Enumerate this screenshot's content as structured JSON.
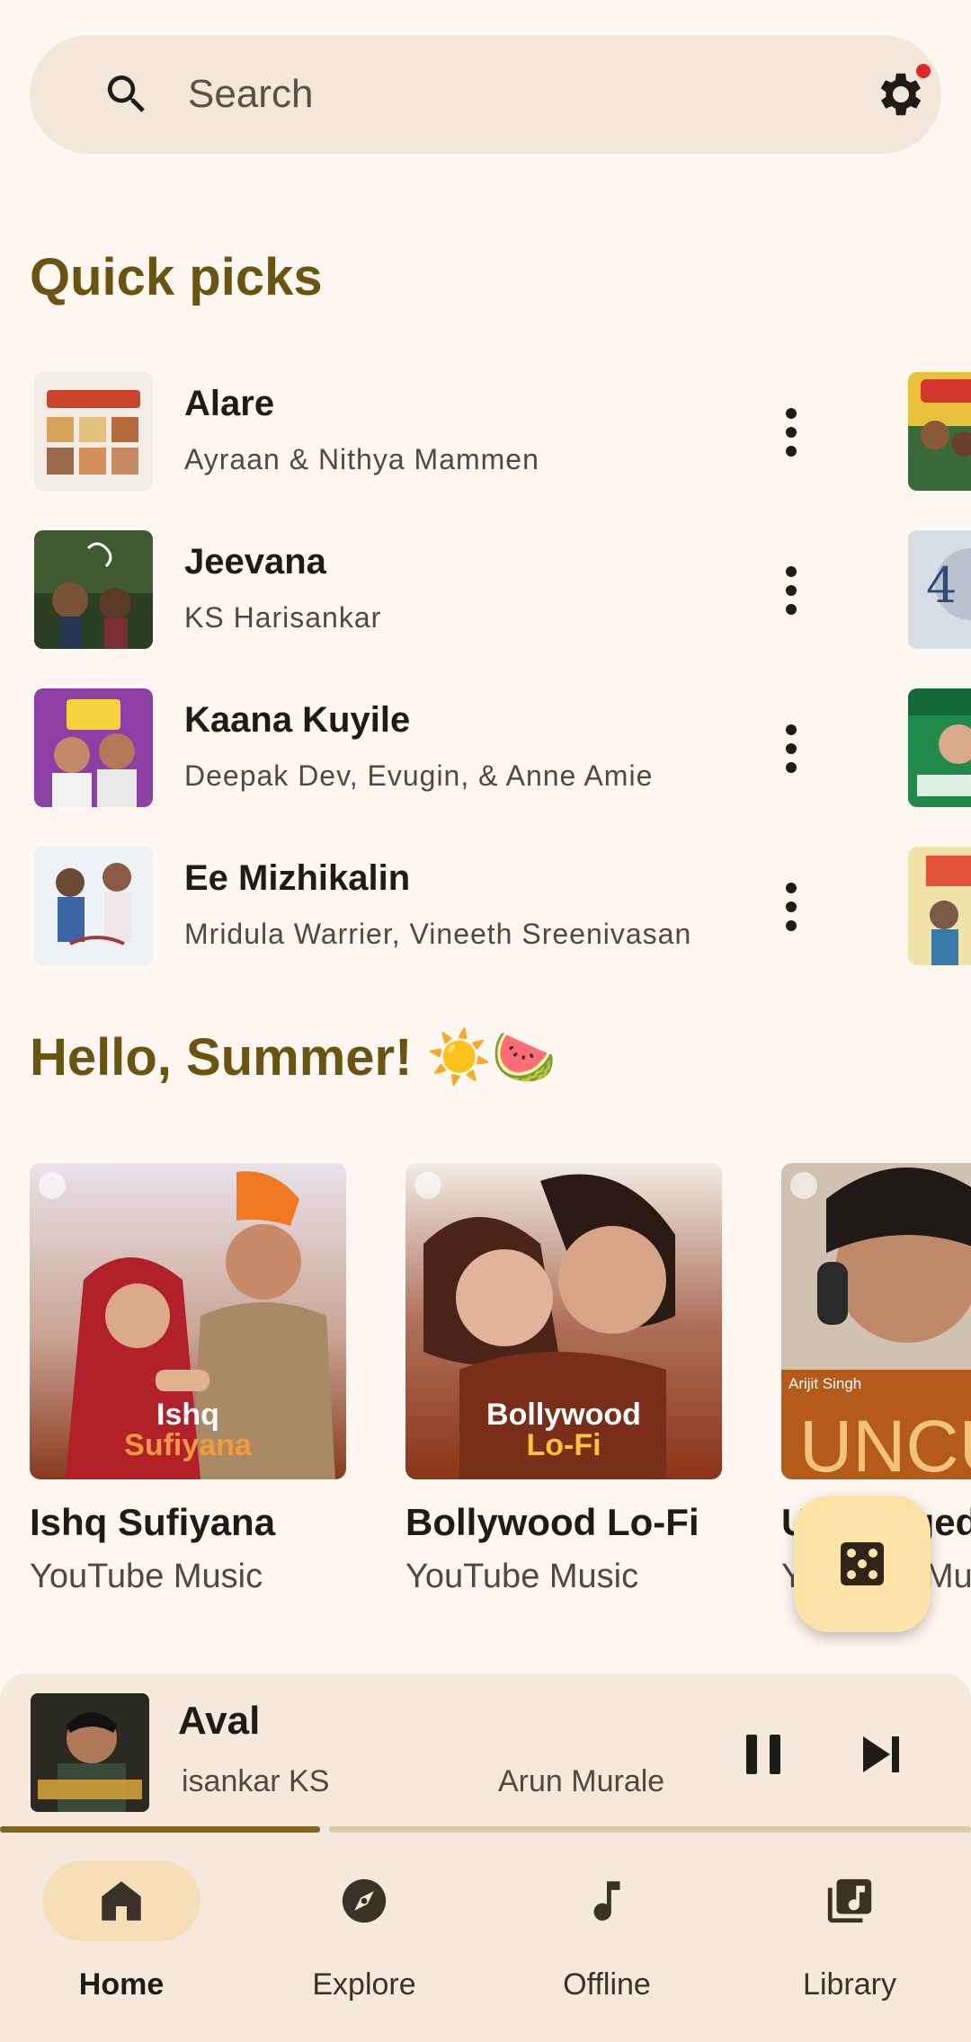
{
  "search": {
    "placeholder": "Search",
    "icons": {
      "left": "search-icon",
      "right": "settings-gear-icon",
      "notification_dot_color": "#e3272d"
    }
  },
  "quick_picks": {
    "title": "Quick picks",
    "items": [
      {
        "title": "Alare",
        "artist": "Ayraan & Nithya Mammen"
      },
      {
        "title": "Jeevana",
        "artist": "KS Harisankar"
      },
      {
        "title": "Kaana Kuyile",
        "artist": "Deepak Dev, Evugin, & Anne Amie"
      },
      {
        "title": "Ee Mizhikalin",
        "artist": "Mridula Warrier, Vineeth Sreenivasan"
      }
    ]
  },
  "summer": {
    "title": "Hello, Summer! ☀️🍉",
    "cards": [
      {
        "title": "Ishq Sufiyana",
        "subtitle": "YouTube Music",
        "art_line1": "Ishq",
        "art_line2": "Sufiyana"
      },
      {
        "title": "Bollywood Lo-Fi",
        "subtitle": "YouTube Music",
        "art_line1": "Bollywood",
        "art_line2": "Lo-Fi"
      },
      {
        "title": "Unplugged Bollywood",
        "subtitle": "YouTube Music",
        "art_label": "Arijit Singh",
        "art_big": "UNCU"
      }
    ]
  },
  "fab": {
    "icon": "dice-shuffle-icon"
  },
  "player": {
    "title": "Aval",
    "artist_part1": "isankar KS",
    "artist_part2": "Arun Murale",
    "progress": 0.33,
    "controls": {
      "pause": "pause-icon",
      "next": "skip-next-icon"
    }
  },
  "nav": {
    "items": [
      {
        "label": "Home",
        "icon": "home-icon",
        "active": true
      },
      {
        "label": "Explore",
        "icon": "compass-icon",
        "active": false
      },
      {
        "label": "Offline",
        "icon": "music-note-icon",
        "active": false
      },
      {
        "label": "Library",
        "icon": "library-icon",
        "active": false
      }
    ]
  },
  "colors": {
    "background": "#fff8f2",
    "accent_title": "#6b5410",
    "surface": "#f4e9dc",
    "fab": "#fde3a6",
    "active_pill": "#f6dfb8"
  }
}
